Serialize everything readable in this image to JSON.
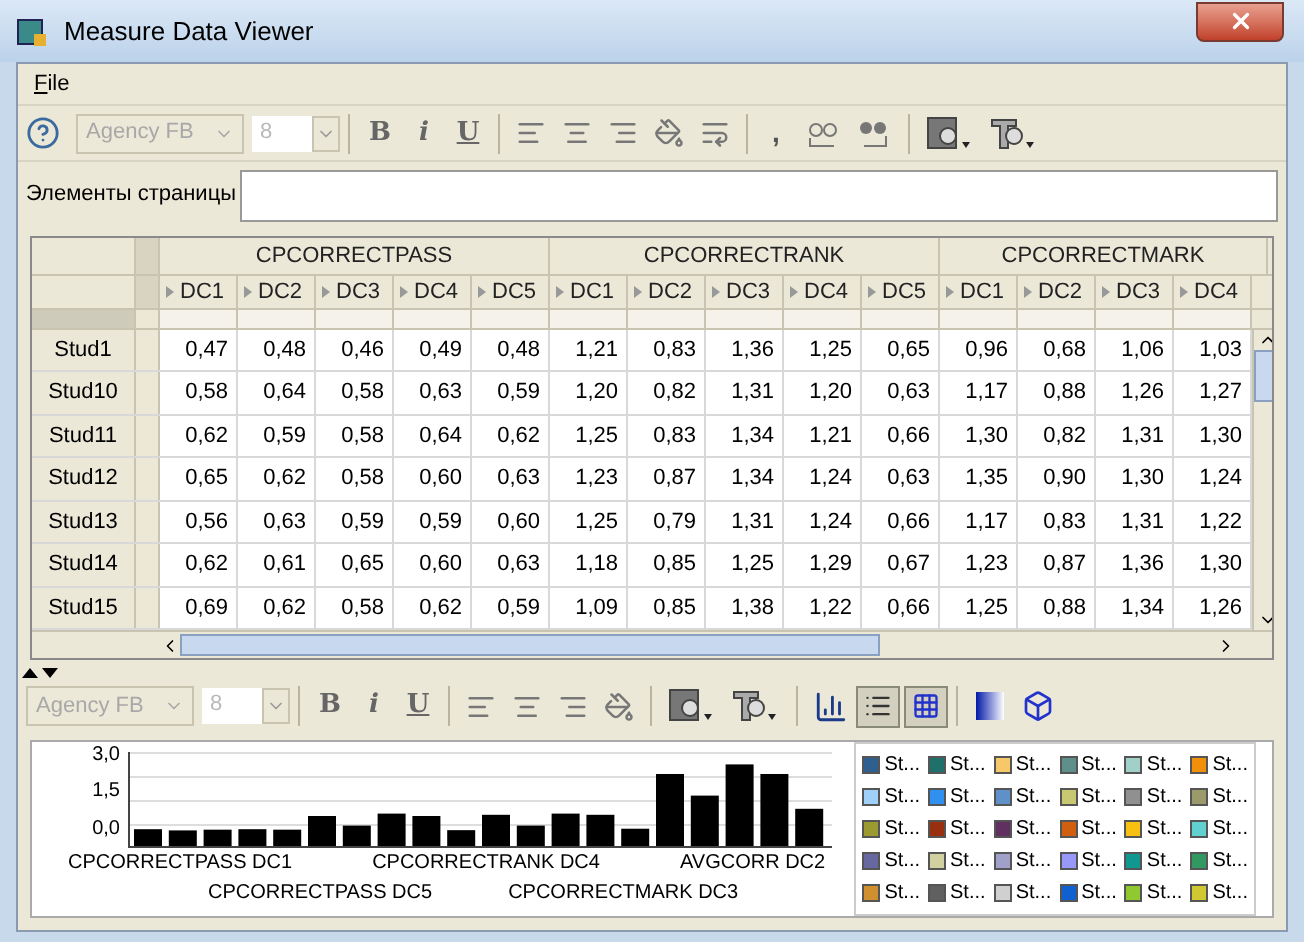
{
  "window": {
    "title": "Measure Data Viewer"
  },
  "menu": [
    {
      "label": "File"
    }
  ],
  "toolbar": {
    "font": "Agency FB",
    "size": "8",
    "format_buttons": [
      "B",
      "i",
      "U"
    ],
    "comma": ","
  },
  "page_elements": {
    "label": "Элементы страницы"
  },
  "grid": {
    "groups": [
      {
        "label": "CPCORRECTPASS",
        "columns": [
          "DC1",
          "DC2",
          "DC3",
          "DC4",
          "DC5"
        ]
      },
      {
        "label": "CPCORRECTRANK",
        "columns": [
          "DC1",
          "DC2",
          "DC3",
          "DC4",
          "DC5"
        ]
      },
      {
        "label": "CPCORRECTMARK",
        "columns": [
          "DC1",
          "DC2",
          "DC3",
          "DC4"
        ]
      }
    ],
    "rows": [
      {
        "label": "Stud1",
        "values": [
          "0,47",
          "0,48",
          "0,46",
          "0,49",
          "0,48",
          "1,21",
          "0,83",
          "1,36",
          "1,25",
          "0,65",
          "0,96",
          "0,68",
          "1,06",
          "1,03"
        ]
      },
      {
        "label": "Stud10",
        "values": [
          "0,58",
          "0,64",
          "0,58",
          "0,63",
          "0,59",
          "1,20",
          "0,82",
          "1,31",
          "1,20",
          "0,63",
          "1,17",
          "0,88",
          "1,26",
          "1,27"
        ]
      },
      {
        "label": "Stud11",
        "values": [
          "0,62",
          "0,59",
          "0,58",
          "0,64",
          "0,62",
          "1,25",
          "0,83",
          "1,34",
          "1,21",
          "0,66",
          "1,30",
          "0,82",
          "1,31",
          "1,30"
        ]
      },
      {
        "label": "Stud12",
        "values": [
          "0,65",
          "0,62",
          "0,58",
          "0,60",
          "0,63",
          "1,23",
          "0,87",
          "1,34",
          "1,24",
          "0,63",
          "1,35",
          "0,90",
          "1,30",
          "1,24"
        ]
      },
      {
        "label": "Stud13",
        "values": [
          "0,56",
          "0,63",
          "0,59",
          "0,59",
          "0,60",
          "1,25",
          "0,79",
          "1,31",
          "1,24",
          "0,66",
          "1,17",
          "0,83",
          "1,31",
          "1,22"
        ]
      },
      {
        "label": "Stud14",
        "values": [
          "0,62",
          "0,61",
          "0,65",
          "0,60",
          "0,63",
          "1,18",
          "0,85",
          "1,25",
          "1,29",
          "0,67",
          "1,23",
          "0,87",
          "1,36",
          "1,30"
        ]
      },
      {
        "label": "Stud15",
        "values": [
          "0,69",
          "0,62",
          "0,58",
          "0,62",
          "0,59",
          "1,09",
          "0,85",
          "1,38",
          "1,22",
          "0,66",
          "1,25",
          "0,88",
          "1,34",
          "1,26"
        ]
      }
    ]
  },
  "chart_toolbar": {
    "font": "Agency FB",
    "size": "8",
    "format_buttons": [
      "B",
      "i",
      "U"
    ],
    "legend_toggle": {
      "selected": true
    },
    "grid_toggle": {
      "selected": true
    }
  },
  "chart": {
    "yticks": [
      "3,0",
      "1,5",
      "0,0"
    ],
    "xlabels_top": [
      "CPCORRECTPASS DC1",
      "CPCORRECTRANK DC4",
      "AVGCORR DC2"
    ],
    "xlabels_bottom": [
      "CPCORRECTPASS DC5",
      "CPCORRECTMARK DC3"
    ]
  },
  "legend": [
    {
      "label": "St...",
      "color": "#2f5f8f"
    },
    {
      "label": "St...",
      "color": "#1f6f6a"
    },
    {
      "label": "St...",
      "color": "#f7c86a"
    },
    {
      "label": "St...",
      "color": "#5f8f8a"
    },
    {
      "label": "St...",
      "color": "#a0d0c8"
    },
    {
      "label": "St...",
      "color": "#f0900a"
    },
    {
      "label": "St...",
      "color": "#a0d0f8"
    },
    {
      "label": "St...",
      "color": "#3090f0"
    },
    {
      "label": "St...",
      "color": "#6090c8"
    },
    {
      "label": "St...",
      "color": "#c8c870"
    },
    {
      "label": "St...",
      "color": "#909090"
    },
    {
      "label": "St...",
      "color": "#9a9a6a"
    },
    {
      "label": "St...",
      "color": "#9a9a30"
    },
    {
      "label": "St...",
      "color": "#983010"
    },
    {
      "label": "St...",
      "color": "#603060"
    },
    {
      "label": "St...",
      "color": "#d06010"
    },
    {
      "label": "St...",
      "color": "#f8c010"
    },
    {
      "label": "St...",
      "color": "#60d0d0"
    },
    {
      "label": "St...",
      "color": "#6868a0"
    },
    {
      "label": "St...",
      "color": "#d0d0a0"
    },
    {
      "label": "St...",
      "color": "#a0a0c8"
    },
    {
      "label": "St...",
      "color": "#9898f8"
    },
    {
      "label": "St...",
      "color": "#109890"
    },
    {
      "label": "St...",
      "color": "#309860"
    },
    {
      "label": "St...",
      "color": "#d09030"
    },
    {
      "label": "St...",
      "color": "#606060"
    },
    {
      "label": "St...",
      "color": "#d0d0d0"
    },
    {
      "label": "St...",
      "color": "#1060d0"
    },
    {
      "label": "St...",
      "color": "#90c830"
    },
    {
      "label": "St...",
      "color": "#d0c830"
    }
  ]
}
